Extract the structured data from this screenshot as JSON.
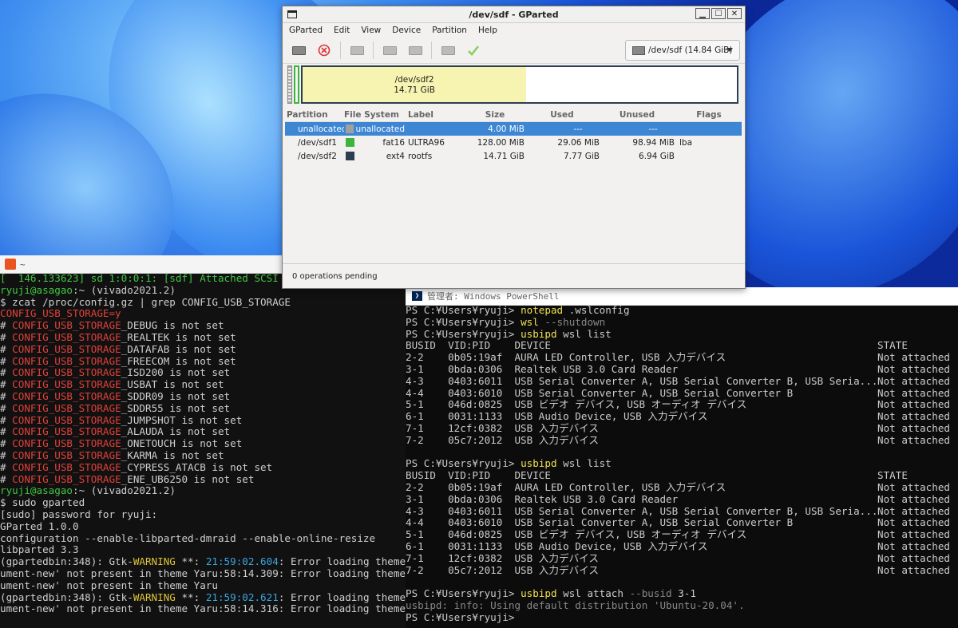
{
  "gparted": {
    "title": "/dev/sdf - GParted",
    "menu": [
      "GParted",
      "Edit",
      "View",
      "Device",
      "Partition",
      "Help"
    ],
    "device_selector": "/dev/sdf  (14.84 GiB)",
    "disk_map_label": "/dev/sdf2",
    "disk_map_size": "14.71 GiB",
    "columns": [
      "Partition",
      "File System",
      "Label",
      "Size",
      "Used",
      "Unused",
      "Flags"
    ],
    "rows": [
      {
        "partition": "unallocated",
        "fs": "unallocated",
        "label": "",
        "size": "4.00 MiB",
        "used": "---",
        "unused": "---",
        "flags": "",
        "color": "#a0a0a0"
      },
      {
        "partition": "/dev/sdf1",
        "fs": "fat16",
        "label": "ULTRA96",
        "size": "128.00 MiB",
        "used": "29.06 MiB",
        "unused": "98.94 MiB",
        "flags": "lba",
        "color": "#3bb53b"
      },
      {
        "partition": "/dev/sdf2",
        "fs": "ext4",
        "label": "rootfs",
        "size": "14.71 GiB",
        "used": "7.77 GiB",
        "unused": "6.94 GiB",
        "flags": "",
        "color": "#2c3e50"
      }
    ],
    "status": "0 operations pending",
    "colors": {
      "selection": "#3d86d4",
      "fat16": "#3bb53b",
      "ext4": "#2c3e50",
      "used": "#f7f3b1"
    }
  },
  "terminal": {
    "title": "~",
    "line0": "[  146.133623] sd 1:0:0:1: [sdf] Attached SCSI r",
    "prompt_user": "ryuji@asagao",
    "prompt_rest": ":~ (vivado2021.2)",
    "cmd1": "$ zcat /proc/config.gz | grep CONFIG_USB_STORAGE",
    "config_yes": "CONFIG_USB_STORAGE=y",
    "not_set": [
      "# CONFIG_USB_STORAGE_DEBUG is not set",
      "# CONFIG_USB_STORAGE_REALTEK is not set",
      "# CONFIG_USB_STORAGE_DATAFAB is not set",
      "# CONFIG_USB_STORAGE_FREECOM is not set",
      "# CONFIG_USB_STORAGE_ISD200 is not set",
      "# CONFIG_USB_STORAGE_USBAT is not set",
      "# CONFIG_USB_STORAGE_SDDR09 is not set",
      "# CONFIG_USB_STORAGE_SDDR55 is not set",
      "# CONFIG_USB_STORAGE_JUMPSHOT is not set",
      "# CONFIG_USB_STORAGE_ALAUDA is not set",
      "# CONFIG_USB_STORAGE_ONETOUCH is not set",
      "# CONFIG_USB_STORAGE_KARMA is not set",
      "# CONFIG_USB_STORAGE_CYPRESS_ATACB is not set",
      "# CONFIG_USB_STORAGE_ENE_UB6250 is not set"
    ],
    "cmd2": "$ sudo gparted",
    "sudo": "[sudo] password for ryuji:",
    "ver": "GParted 1.0.0",
    "conf": "configuration --enable-libparted-dmraid --enable-online-resize",
    "lib": "libparted 3.3",
    "warn1_a": "(gpartedbin:348): Gtk-",
    "warn_word": "WARNING",
    "warn1_b": " **: ",
    "warn1_time": "21:59:02.604",
    "warn1_c": ": Error loading theme i",
    "warn1_d": "ument-new' not present in theme Yaru:58:14.309: Error loading theme i",
    "warn1_e": "ument-new' not present in theme Yaru",
    "warn2_time": "21:59:02.621",
    "warn2_d": "ument-new' not present in theme Yaru:58:14.316: Error loading theme i"
  },
  "powershell": {
    "title": "管理者: Windows PowerShell",
    "prompt": "PS C:¥Users¥ryuji> ",
    "c1": "notepad",
    "c1a": " .wslconfig",
    "c2": "wsl",
    "c2a": " --shutdown",
    "c3": "usbipd",
    "c3a": " wsl list",
    "header": "BUSID  VID:PID    DEVICE",
    "header_state": "STATE",
    "devices": [
      "2-2    0b05:19af  AURA LED Controller, USB 入力デバイス",
      "3-1    0bda:0306  Realtek USB 3.0 Card Reader",
      "4-3    0403:6011  USB Serial Converter A, USB Serial Converter B, USB Seria...",
      "4-4    0403:6010  USB Serial Converter A, USB Serial Converter B",
      "5-1    046d:0825  USB ビデオ デバイス, USB オーディオ デバイス",
      "6-1    0031:1133  USB Audio Device, USB 入力デバイス",
      "7-1    12cf:0382  USB 入力デバイス",
      "7-2    05c7:2012  USB 入力デバイス"
    ],
    "state": "Not attached",
    "c4a": " wsl attach ",
    "c4b": "--busid",
    "c4c": " 3-1",
    "info": "usbipd: info: Using default distribution 'Ubuntu-20.04'."
  }
}
